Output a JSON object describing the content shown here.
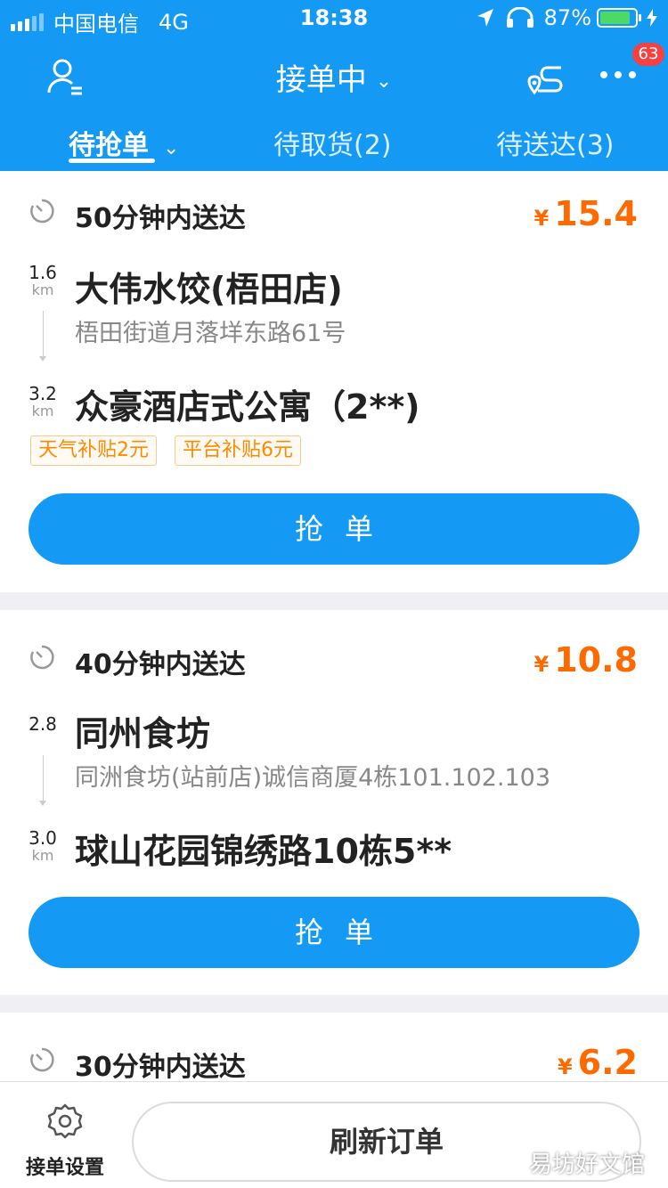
{
  "status_bar": {
    "carrier": "中国电信",
    "network": "4G",
    "time": "18:38",
    "battery_pct": "87%",
    "battery_level": 0.87
  },
  "header": {
    "title": "接单中",
    "notification_count": "63",
    "tabs": [
      {
        "label": "待抢单",
        "active": true
      },
      {
        "label": "待取货(2)",
        "active": false
      },
      {
        "label": "待送达(3)",
        "active": false
      }
    ]
  },
  "orders": [
    {
      "delivery_time": "50分钟内送达",
      "currency": "¥",
      "price": "15.4",
      "pickup": {
        "distance": "1.6",
        "unit": "km",
        "name": "大伟水饺(梧田店)",
        "address": "梧田街道月落垟东路61号"
      },
      "dropoff": {
        "distance": "3.2",
        "unit": "km",
        "name": "众豪酒店式公寓（2**)"
      },
      "tags": [
        "天气补贴2元",
        "平台补贴6元"
      ],
      "action": "抢单"
    },
    {
      "delivery_time": "40分钟内送达",
      "currency": "¥",
      "price": "10.8",
      "pickup": {
        "distance": "2.8",
        "unit": "",
        "name": "同州食坊",
        "address": "同洲食坊(站前店)诚信商厦4栋101.102.103"
      },
      "dropoff": {
        "distance": "3.0",
        "unit": "km",
        "name": "球山花园锦绣路10栋5**"
      },
      "tags": [],
      "action": "抢单"
    },
    {
      "delivery_time": "30分钟内送达",
      "currency": "¥",
      "price": "6.2"
    }
  ],
  "bottom": {
    "settings_label": "接单设置",
    "refresh_label": "刷新订单"
  },
  "watermark": "易坊好文馆",
  "colors": {
    "primary": "#1499f5",
    "price": "#ff6a00",
    "tag": "#ff8a00",
    "badge": "#f54141",
    "battery": "#4cd964"
  }
}
